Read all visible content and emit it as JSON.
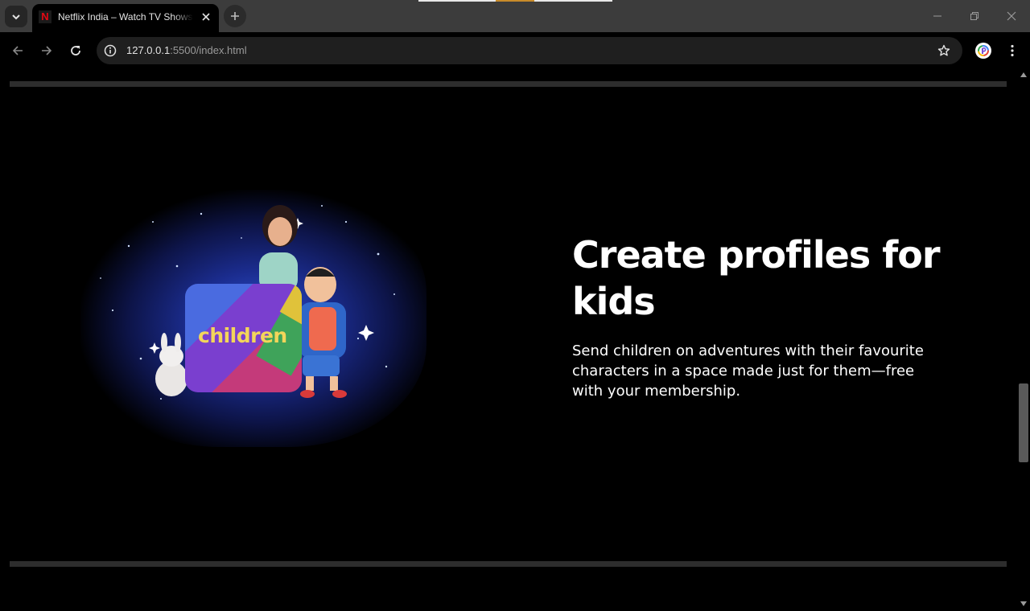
{
  "browser": {
    "tab": {
      "favicon_letter": "N",
      "title": "Netflix India – Watch TV Shows Online",
      "close_icon": "close-icon"
    },
    "address": {
      "host": "127.0.0.1",
      "path": ":5500/index.html"
    },
    "icons": [
      "tab-search-icon",
      "new-tab-icon",
      "minimize-icon",
      "restore-icon",
      "window-close-icon",
      "back-icon",
      "forward-icon",
      "reload-icon",
      "site-info-icon",
      "bookmark-star-icon",
      "profile-avatar-icon",
      "more-menu-icon"
    ]
  },
  "page": {
    "feature": {
      "illustration_text": "children",
      "headline": "Create profiles for kids",
      "body": "Send children on adventures with their favourite characters in a space made just for them—free with your membership."
    }
  },
  "colors": {
    "background": "#000000",
    "divider": "#2d2d2d",
    "brand_red": "#e50914",
    "text": "#ffffff"
  }
}
